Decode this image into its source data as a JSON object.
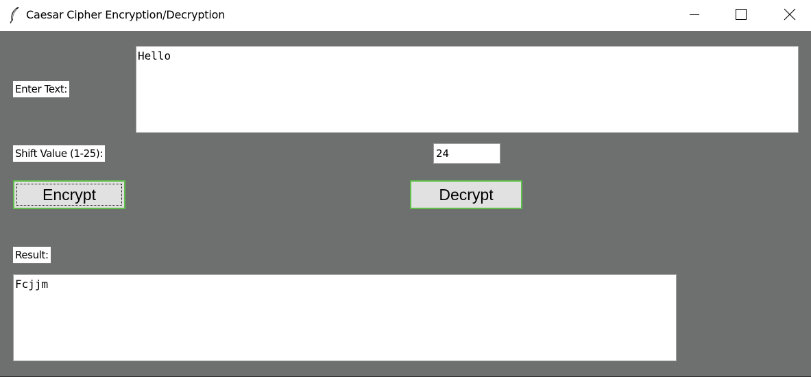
{
  "window": {
    "title": "Caesar Cipher Encryption/Decryption",
    "icon": "feather-icon",
    "controls": [
      "minimize-icon",
      "maximize-icon",
      "close-icon"
    ]
  },
  "form": {
    "input_label": "Enter Text:",
    "input_value": "Hello",
    "shift_label": "Shift Value (1-25):",
    "shift_value": "24",
    "encrypt_label": "Encrypt",
    "decrypt_label": "Decrypt",
    "result_label": "Result:",
    "result_value": "Fcjjm"
  },
  "colors": {
    "background": "#6d706e",
    "button_border": "#5fbf4a",
    "button_face": "#e1e1e1"
  }
}
